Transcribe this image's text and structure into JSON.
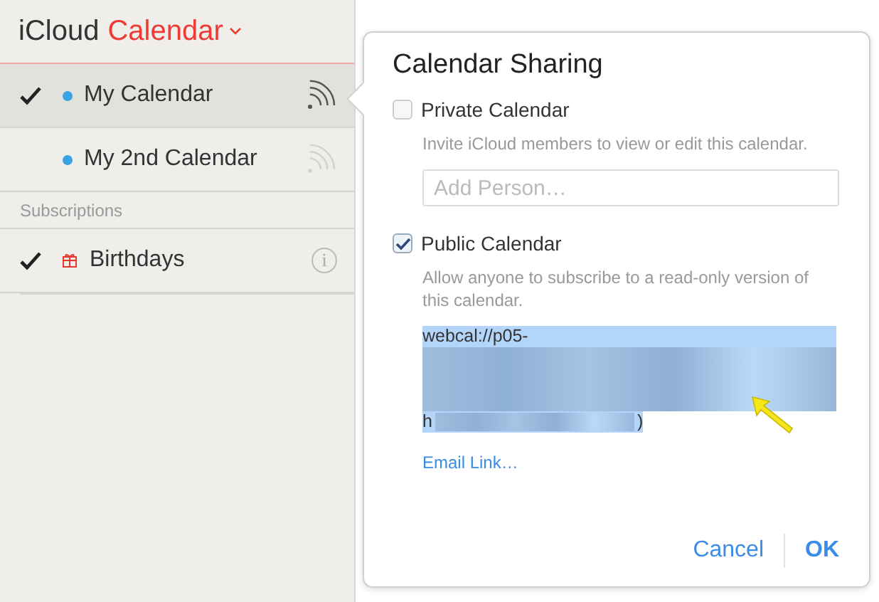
{
  "header": {
    "brand": "iCloud",
    "app": "Calendar"
  },
  "calendars": [
    {
      "name": "My Calendar",
      "checked": true,
      "selected": true,
      "color": "#3aa3e3",
      "shared": true
    },
    {
      "name": "My 2nd Calendar",
      "checked": false,
      "selected": false,
      "color": "#3aa3e3",
      "shared": false
    }
  ],
  "subscriptions": {
    "heading": "Subscriptions",
    "items": [
      {
        "name": "Birthdays",
        "checked": true,
        "info": "i"
      }
    ]
  },
  "sharing": {
    "title": "Calendar Sharing",
    "private": {
      "label": "Private Calendar",
      "checked": false,
      "description": "Invite iCloud members to view or edit this calendar.",
      "placeholder": "Add Person…"
    },
    "public": {
      "label": "Public Calendar",
      "checked": true,
      "description": "Allow anyone to subscribe to a read-only version of this calendar.",
      "url_start": "webcal://p05-",
      "url_last_start": "h",
      "url_end": ")"
    },
    "email_link": "Email Link…",
    "cancel": "Cancel",
    "ok": "OK"
  }
}
